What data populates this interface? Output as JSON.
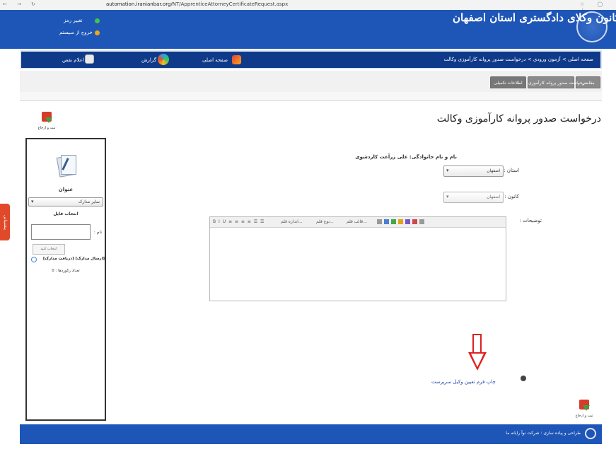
{
  "browser": {
    "nav_icons": "← → ↻",
    "url_host": "automation.iranianbar.org",
    "url_path": "/NT/ApprenticeAttorneyCertificateRequest.aspx",
    "right_icons": "☆ ◯ ⋮"
  },
  "header": {
    "site_title": "کانون وکلای دادگستری استان اصفهان",
    "change_password": "تغییر رمز",
    "logout": "خروج از سیستم"
  },
  "navbar": {
    "breadcrumb": "صفحه اصلی > آزمون ورودی > درخواست صدور پروانه کارآموزی وکالت",
    "home": "صفحه اصلی",
    "reports": "گزارش",
    "mail": "اعلام نقص"
  },
  "tabs": [
    {
      "label": "مقاضی"
    },
    {
      "label": "درخواست صدور پروانه کارآموزی"
    },
    {
      "label": "اطلاعات تکمیلی"
    }
  ],
  "page": {
    "title": "درخواست صدور پروانه کارآموزی وکالت",
    "save_label": "ثبت و ارجاع",
    "applicant_name_label": "نام و نام خانوادگی: علی زرآعت کاردشوی",
    "province_label": "استان :",
    "province_value": "اصفهان",
    "bar_label": "کانون :",
    "bar_value": "اصفهان",
    "description_label": "توضیحات :",
    "print_link": "چاپ فرم تعیین وکیل سرپرست"
  },
  "editor": {
    "format_buttons": "B  I  U  ≡  ≡  ≡  ≡  ☰  ☰",
    "font_size": "اندازه قلم...",
    "font_type": "نوع قلم...",
    "font_format": "قالب قلم..."
  },
  "sidebar": {
    "title": "عنوان",
    "doc_type": "سایر مدارک",
    "choose_file": "انتخاب فایل",
    "name_label": "نام :",
    "select_button": "انتخاب کنید",
    "links": "[ارسال مدارک] [دریافت مدارک]",
    "record_count": "تعداد رکوردها : 0"
  },
  "side_tab": "پشتیبانی",
  "footer": {
    "credit": "طراحی و پیاده سازی : شرکت نوآ رایانه ما"
  },
  "colors": {
    "header_blue": "#1e56b8",
    "navbar_blue": "#0f3a8a",
    "arrow_red": "#e02020",
    "save_red": "#d63b2b"
  }
}
